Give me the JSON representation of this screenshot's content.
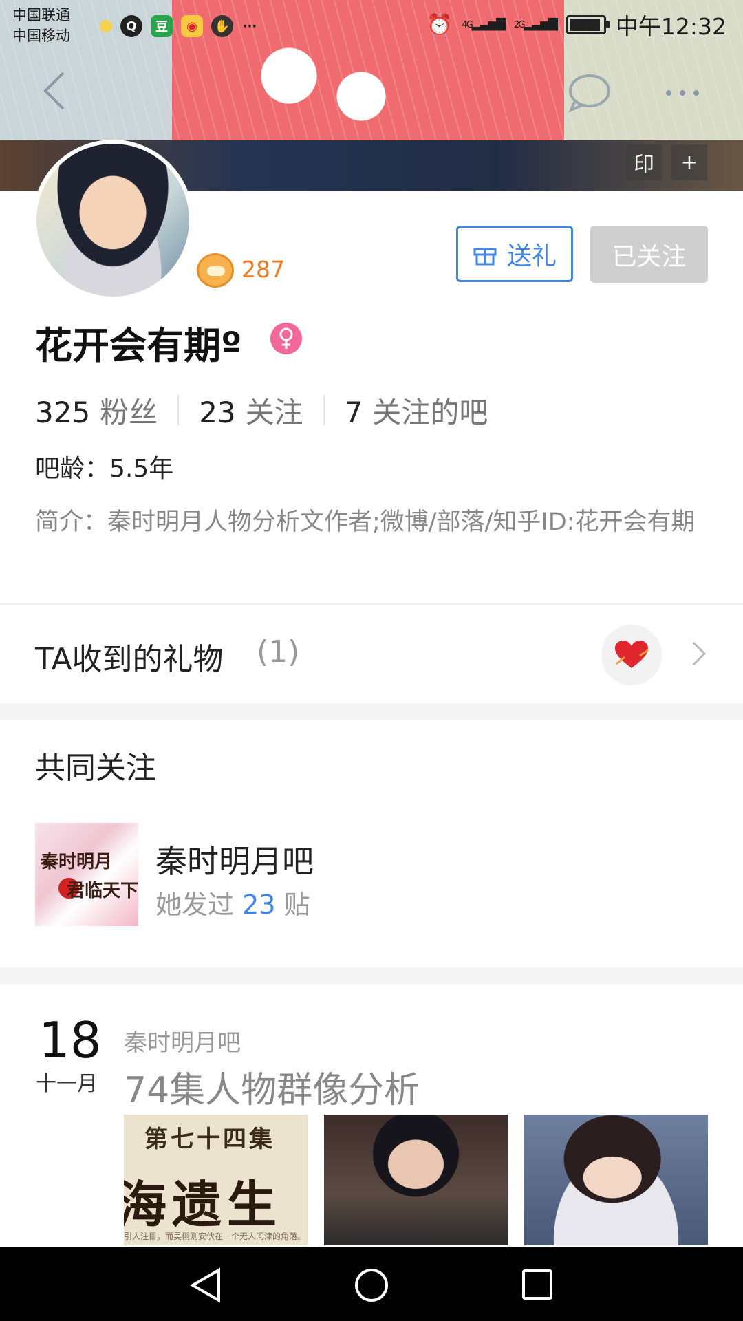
{
  "status_bar": {
    "carrier_1": "中国联通",
    "carrier_2": "中国移动",
    "network_1": "4G",
    "network_2": "2G",
    "time": "中午12:32",
    "app_icons": [
      "qq-browser-icon",
      "douban-icon",
      "weibo-icon",
      "hand-icon",
      "more-dots-icon"
    ]
  },
  "header": {
    "cover_buttons": [
      "印",
      "+"
    ]
  },
  "profile": {
    "level": "287",
    "gift_button_label": "送礼",
    "follow_button_label": "已关注",
    "username": "花开会有期º",
    "gender": "female",
    "stats": [
      {
        "value": "325",
        "label": "粉丝"
      },
      {
        "value": "23",
        "label": "关注"
      },
      {
        "value": "7",
        "label": "关注的吧"
      }
    ],
    "age_label": "吧龄：",
    "age_value": "5.5年",
    "intro": "简介：秦时明月人物分析文作者;微博/部落/知乎ID:花开会有期"
  },
  "gifts": {
    "title": "TA收到的礼物",
    "count": "(1)"
  },
  "common_follow": {
    "title": "共同关注",
    "bar_name": "秦时明月吧",
    "posts_prefix": "她发过",
    "posts_count": "23",
    "posts_suffix": "贴",
    "thumb_text_1": "秦时明月",
    "thumb_text_2": "君临天下"
  },
  "post": {
    "day": "18",
    "month": "十一月",
    "bar": "秦时明月吧",
    "title": "74集人物群像分析",
    "thumb_1_line_1": "第七十四集",
    "thumb_1_line_2": "海遗生",
    "thumb_1_line_3": "引人注目，而吴栩则安伏在一个无人问津的角落。"
  },
  "colors": {
    "accent_blue": "#3f86e6",
    "level_orange": "#f1791e",
    "female_pink": "#f2689a"
  }
}
